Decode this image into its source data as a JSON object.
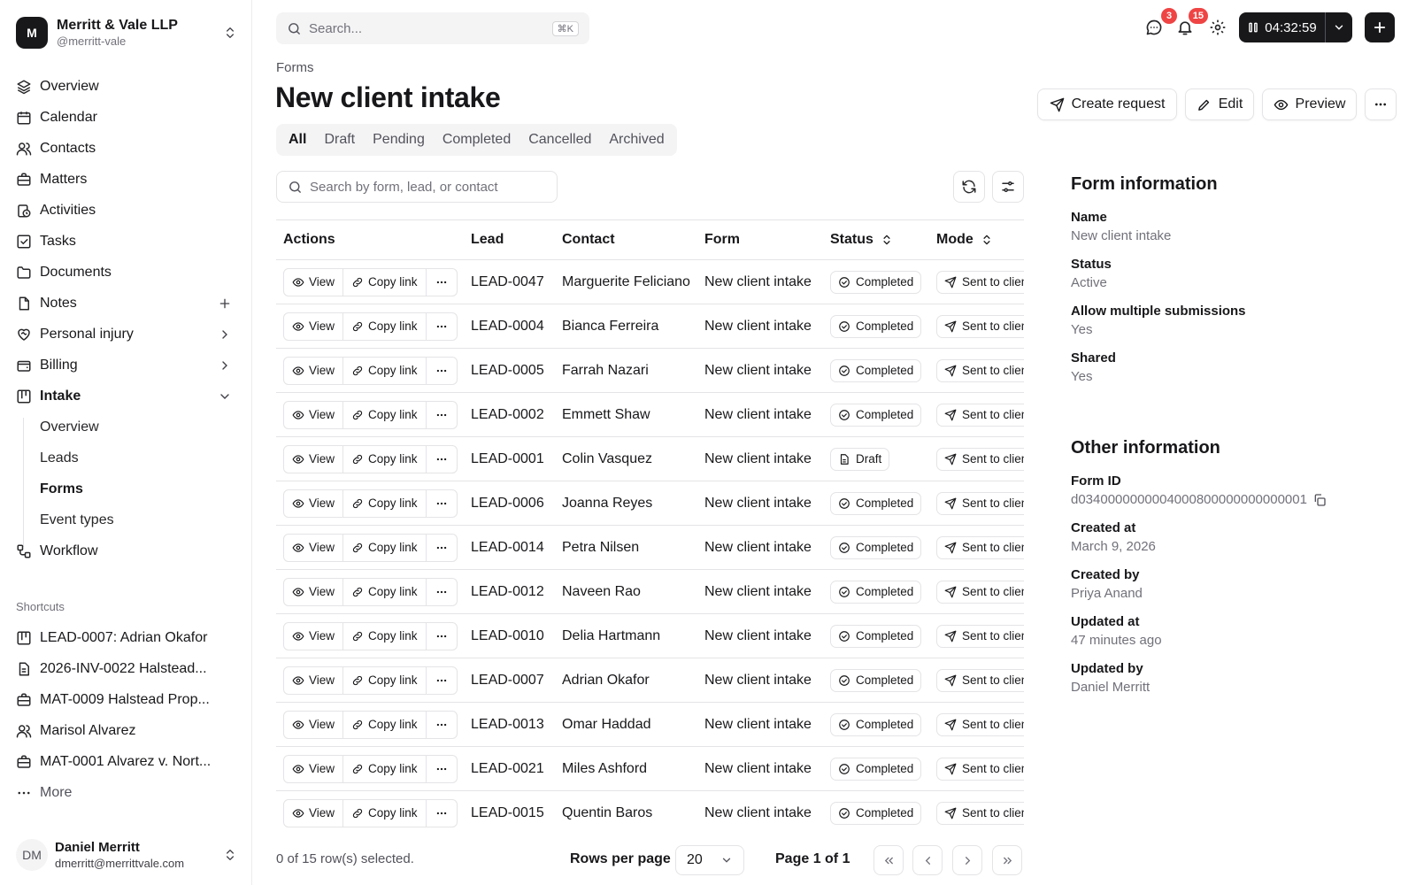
{
  "org": {
    "logo_letter": "M",
    "name": "Merritt & Vale LLP",
    "handle": "@merritt-vale"
  },
  "nav": {
    "overview": "Overview",
    "calendar": "Calendar",
    "contacts": "Contacts",
    "matters": "Matters",
    "activities": "Activities",
    "tasks": "Tasks",
    "documents": "Documents",
    "notes": "Notes",
    "personal_injury": "Personal injury",
    "billing": "Billing",
    "intake": "Intake",
    "workflow": "Workflow",
    "intake_sub": {
      "overview": "Overview",
      "leads": "Leads",
      "forms": "Forms",
      "event_types": "Event types"
    }
  },
  "shortcuts": {
    "label": "Shortcuts",
    "items": [
      "LEAD-0007: Adrian Okafor",
      "2026-INV-0022 Halstead...",
      "MAT-0009 Halstead Prop...",
      "Marisol Alvarez",
      "MAT-0001 Alvarez v. Nort..."
    ],
    "more": "More"
  },
  "user": {
    "initials": "DM",
    "name": "Daniel Merritt",
    "email": "dmerritt@merrittvale.com"
  },
  "topbar": {
    "search_placeholder": "Search...",
    "shortcut": "⌘K",
    "messages_count": "3",
    "notifications_count": "15",
    "timer": "04:32:59"
  },
  "page": {
    "breadcrumb": "Forms",
    "title": "New client intake",
    "buttons": {
      "create_request": "Create request",
      "edit": "Edit",
      "preview": "Preview"
    }
  },
  "tabs": [
    "All",
    "Draft",
    "Pending",
    "Completed",
    "Cancelled",
    "Archived"
  ],
  "table": {
    "search_placeholder": "Search by form, lead, or contact",
    "headers": {
      "actions": "Actions",
      "lead": "Lead",
      "contact": "Contact",
      "form": "Form",
      "status": "Status",
      "mode": "Mode"
    },
    "action_labels": {
      "view": "View",
      "copy": "Copy link"
    },
    "rows": [
      {
        "lead": "LEAD-0047",
        "contact": "Marguerite Feliciano",
        "form": "New client intake",
        "status": "Completed",
        "mode": "Sent to client"
      },
      {
        "lead": "LEAD-0004",
        "contact": "Bianca Ferreira",
        "form": "New client intake",
        "status": "Completed",
        "mode": "Sent to client"
      },
      {
        "lead": "LEAD-0005",
        "contact": "Farrah Nazari",
        "form": "New client intake",
        "status": "Completed",
        "mode": "Sent to client"
      },
      {
        "lead": "LEAD-0002",
        "contact": "Emmett Shaw",
        "form": "New client intake",
        "status": "Completed",
        "mode": "Sent to client"
      },
      {
        "lead": "LEAD-0001",
        "contact": "Colin Vasquez",
        "form": "New client intake",
        "status": "Draft",
        "mode": "Sent to client"
      },
      {
        "lead": "LEAD-0006",
        "contact": "Joanna Reyes",
        "form": "New client intake",
        "status": "Completed",
        "mode": "Sent to client"
      },
      {
        "lead": "LEAD-0014",
        "contact": "Petra Nilsen",
        "form": "New client intake",
        "status": "Completed",
        "mode": "Sent to client"
      },
      {
        "lead": "LEAD-0012",
        "contact": "Naveen Rao",
        "form": "New client intake",
        "status": "Completed",
        "mode": "Sent to client"
      },
      {
        "lead": "LEAD-0010",
        "contact": "Delia Hartmann",
        "form": "New client intake",
        "status": "Completed",
        "mode": "Sent to client"
      },
      {
        "lead": "LEAD-0007",
        "contact": "Adrian Okafor",
        "form": "New client intake",
        "status": "Completed",
        "mode": "Sent to client"
      },
      {
        "lead": "LEAD-0013",
        "contact": "Omar Haddad",
        "form": "New client intake",
        "status": "Completed",
        "mode": "Sent to client"
      },
      {
        "lead": "LEAD-0021",
        "contact": "Miles Ashford",
        "form": "New client intake",
        "status": "Completed",
        "mode": "Sent to client"
      },
      {
        "lead": "LEAD-0015",
        "contact": "Quentin Baros",
        "form": "New client intake",
        "status": "Completed",
        "mode": "Sent to client"
      }
    ]
  },
  "pagination": {
    "selected": "0 of 15 row(s) selected.",
    "rows_label": "Rows per page",
    "rows_value": "20",
    "page_label": "Page 1 of 1"
  },
  "form_info": {
    "title": "Form information",
    "name_key": "Name",
    "name_val": "New client intake",
    "status_key": "Status",
    "status_val": "Active",
    "multi_key": "Allow multiple submissions",
    "multi_val": "Yes",
    "shared_key": "Shared",
    "shared_val": "Yes"
  },
  "other_info": {
    "title": "Other information",
    "id_key": "Form ID",
    "id_val": "d0340000000004000800000000000001",
    "created_key": "Created at",
    "created_val": "March 9, 2026",
    "created_by_key": "Created by",
    "created_by_val": "Priya Anand",
    "updated_key": "Updated at",
    "updated_val": "47 minutes ago",
    "updated_by_key": "Updated by",
    "updated_by_val": "Daniel Merritt"
  }
}
